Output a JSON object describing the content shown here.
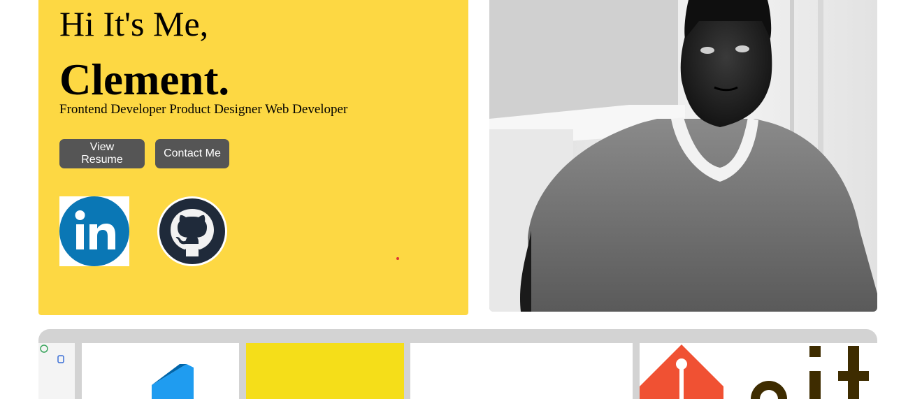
{
  "hero": {
    "greeting": "Hi It's Me,",
    "name": "Clement.",
    "roles": "Frontend Developer Product Designer Web Developer",
    "buttons": {
      "resume": "View Resume",
      "contact": "Contact Me"
    }
  },
  "social": [
    {
      "icon": "linkedin-icon"
    },
    {
      "icon": "github-icon"
    }
  ],
  "profile_photo": {
    "icon": "profile-photo"
  },
  "skills": [
    {
      "icon": "app-icon"
    },
    {
      "icon": "vscode-icon"
    },
    {
      "icon": "javascript-icon"
    },
    {
      "icon": "blank-logo"
    },
    {
      "icon": "git-icon"
    }
  ],
  "colors": {
    "hero_background": "#fdd843",
    "button_background": "#555555",
    "button_text": "#ffffff",
    "strip_background": "#d3d3d3",
    "linkedin_blue": "#0a77b5",
    "github_dark": "#1f2a3a",
    "git_orange": "#f05133"
  }
}
